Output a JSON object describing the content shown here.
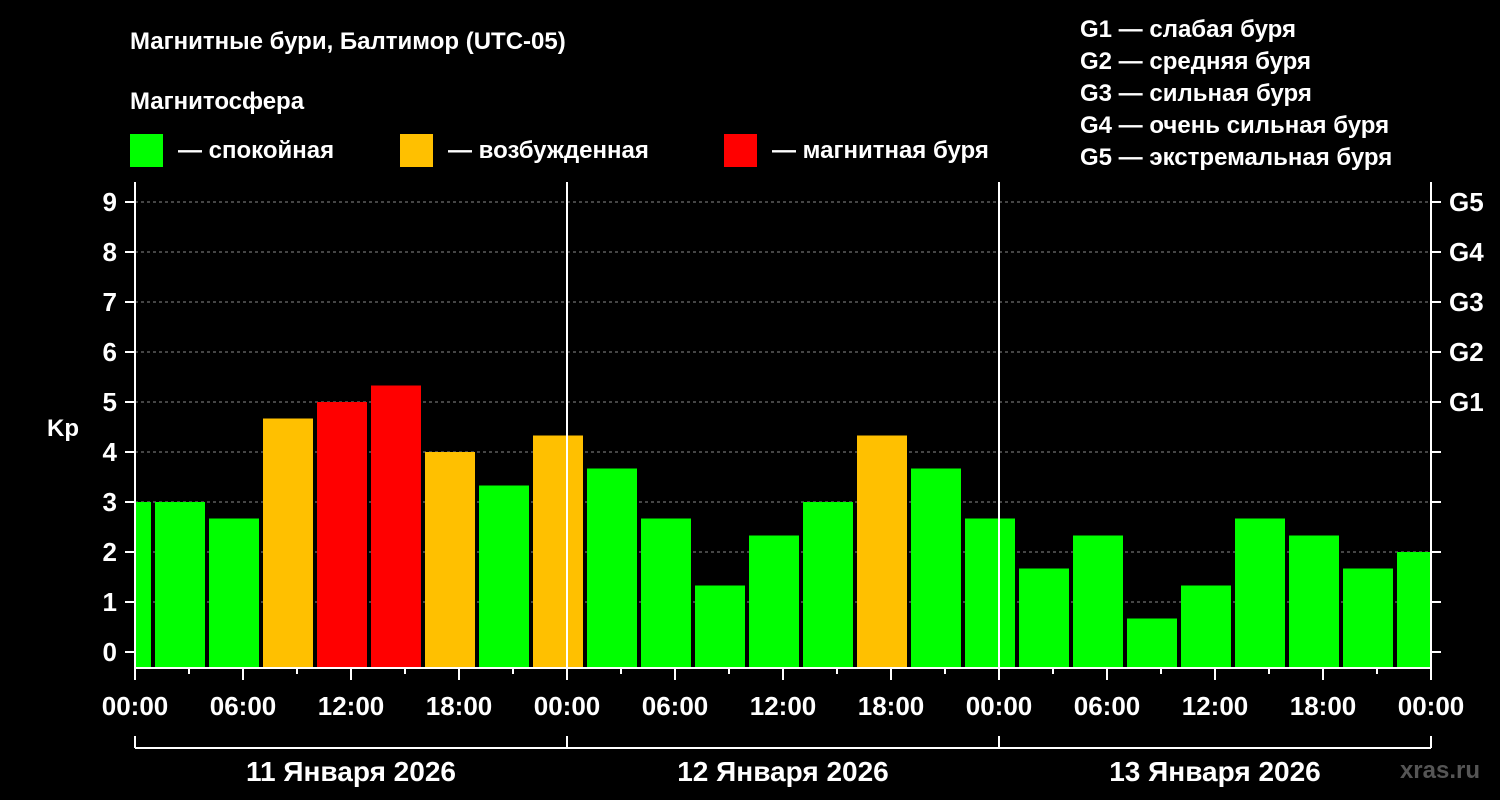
{
  "title": "Магнитные бури, Балтимор (UTC-05)",
  "legend": {
    "heading": "Магнитосфера",
    "items": [
      {
        "label": "— спокойная",
        "color": "#00ff00"
      },
      {
        "label": "— возбужденная",
        "color": "#ffc000"
      },
      {
        "label": "— магнитная буря",
        "color": "#ff0000"
      }
    ]
  },
  "g_scale": [
    "G1 — слабая буря",
    "G2 — средняя буря",
    "G3 — сильная буря",
    "G4 — очень сильная буря",
    "G5 — экстремальная буря"
  ],
  "watermark": "xras.ru",
  "chart_data": {
    "type": "bar",
    "ylabel": "Kp",
    "ylim": [
      0,
      9
    ],
    "y_ticks": [
      "0",
      "1",
      "2",
      "3",
      "4",
      "5",
      "6",
      "7",
      "8",
      "9"
    ],
    "right_labels": [
      {
        "level": 5,
        "label": "G1"
      },
      {
        "level": 6,
        "label": "G2"
      },
      {
        "level": 7,
        "label": "G3"
      },
      {
        "level": 8,
        "label": "G4"
      },
      {
        "level": 9,
        "label": "G5"
      }
    ],
    "x_ticks": [
      "00:00",
      "06:00",
      "12:00",
      "18:00",
      "00:00",
      "06:00",
      "12:00",
      "18:00",
      "00:00",
      "06:00",
      "12:00",
      "18:00",
      "00:00"
    ],
    "x_range_hours": [
      0,
      72
    ],
    "dates": [
      "11 Января 2026",
      "12 Января 2026",
      "13 Января 2026"
    ],
    "grid": true,
    "bars": [
      {
        "start_h": 0,
        "end_h": 1,
        "value": 3.0,
        "color": "#00ff00"
      },
      {
        "start_h": 1,
        "end_h": 4,
        "value": 3.0,
        "color": "#00ff00"
      },
      {
        "start_h": 4,
        "end_h": 7,
        "value": 2.67,
        "color": "#00ff00"
      },
      {
        "start_h": 7,
        "end_h": 10,
        "value": 4.67,
        "color": "#ffc000"
      },
      {
        "start_h": 10,
        "end_h": 13,
        "value": 5.0,
        "color": "#ff0000"
      },
      {
        "start_h": 13,
        "end_h": 16,
        "value": 5.33,
        "color": "#ff0000"
      },
      {
        "start_h": 16,
        "end_h": 19,
        "value": 4.0,
        "color": "#ffc000"
      },
      {
        "start_h": 19,
        "end_h": 22,
        "value": 3.33,
        "color": "#00ff00"
      },
      {
        "start_h": 22,
        "end_h": 25,
        "value": 4.33,
        "color": "#ffc000"
      },
      {
        "start_h": 25,
        "end_h": 28,
        "value": 3.67,
        "color": "#00ff00"
      },
      {
        "start_h": 28,
        "end_h": 31,
        "value": 2.67,
        "color": "#00ff00"
      },
      {
        "start_h": 31,
        "end_h": 34,
        "value": 1.33,
        "color": "#00ff00"
      },
      {
        "start_h": 34,
        "end_h": 37,
        "value": 2.33,
        "color": "#00ff00"
      },
      {
        "start_h": 37,
        "end_h": 40,
        "value": 3.0,
        "color": "#00ff00"
      },
      {
        "start_h": 40,
        "end_h": 43,
        "value": 4.33,
        "color": "#ffc000"
      },
      {
        "start_h": 43,
        "end_h": 46,
        "value": 3.67,
        "color": "#00ff00"
      },
      {
        "start_h": 46,
        "end_h": 49,
        "value": 2.67,
        "color": "#00ff00"
      },
      {
        "start_h": 49,
        "end_h": 52,
        "value": 1.67,
        "color": "#00ff00"
      },
      {
        "start_h": 52,
        "end_h": 55,
        "value": 2.33,
        "color": "#00ff00"
      },
      {
        "start_h": 55,
        "end_h": 58,
        "value": 0.67,
        "color": "#00ff00"
      },
      {
        "start_h": 58,
        "end_h": 61,
        "value": 1.33,
        "color": "#00ff00"
      },
      {
        "start_h": 61,
        "end_h": 64,
        "value": 2.67,
        "color": "#00ff00"
      },
      {
        "start_h": 64,
        "end_h": 67,
        "value": 2.33,
        "color": "#00ff00"
      },
      {
        "start_h": 67,
        "end_h": 70,
        "value": 1.67,
        "color": "#00ff00"
      },
      {
        "start_h": 70,
        "end_h": 72,
        "value": 2.0,
        "color": "#00ff00"
      }
    ]
  }
}
